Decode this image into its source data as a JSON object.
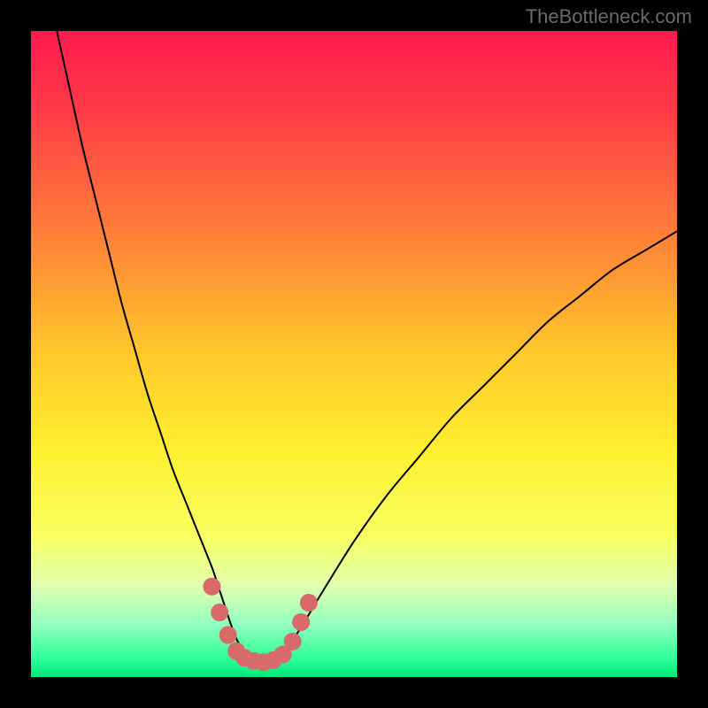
{
  "watermark": "TheBottleneck.com",
  "chart_data": {
    "type": "line",
    "title": "",
    "xlabel": "",
    "ylabel": "",
    "xlim": [
      0,
      100
    ],
    "ylim": [
      0,
      100
    ],
    "background_gradient": {
      "stops": [
        {
          "offset": 0,
          "color": "#ff1a50"
        },
        {
          "offset": 12,
          "color": "#ff3a46"
        },
        {
          "offset": 30,
          "color": "#ff7a3a"
        },
        {
          "offset": 50,
          "color": "#ffc82a"
        },
        {
          "offset": 65,
          "color": "#fff030"
        },
        {
          "offset": 78,
          "color": "#f9ff60"
        },
        {
          "offset": 86,
          "color": "#e0ffb0"
        },
        {
          "offset": 92,
          "color": "#90ffc0"
        },
        {
          "offset": 97,
          "color": "#30ff9a"
        },
        {
          "offset": 100,
          "color": "#00e878"
        }
      ]
    },
    "series": [
      {
        "name": "bottleneck-curve",
        "color": "#000000",
        "x": [
          4,
          6,
          8,
          10,
          12,
          14,
          16,
          18,
          20,
          22,
          24,
          26,
          28,
          29,
          30,
          31,
          32,
          33,
          34,
          35,
          36,
          37,
          38,
          40,
          42,
          45,
          50,
          55,
          60,
          65,
          70,
          75,
          80,
          85,
          90,
          95,
          100
        ],
        "y": [
          100,
          91,
          82,
          74,
          66,
          58,
          51,
          44,
          38,
          32,
          27,
          22,
          17,
          14,
          11,
          8,
          5.5,
          4,
          3,
          2.5,
          2.2,
          2.4,
          3,
          5,
          8,
          13,
          21,
          28,
          34,
          40,
          45,
          50,
          55,
          59,
          63,
          66,
          69
        ]
      }
    ],
    "markers": {
      "name": "highlight-dots",
      "color": "#d96a6a",
      "radius": 10,
      "points": [
        {
          "x": 28.0,
          "y": 14.0
        },
        {
          "x": 29.2,
          "y": 10.0
        },
        {
          "x": 30.5,
          "y": 6.5
        },
        {
          "x": 31.8,
          "y": 4.0
        },
        {
          "x": 33.0,
          "y": 3.0
        },
        {
          "x": 34.5,
          "y": 2.5
        },
        {
          "x": 36.0,
          "y": 2.3
        },
        {
          "x": 37.5,
          "y": 2.6
        },
        {
          "x": 39.0,
          "y": 3.5
        },
        {
          "x": 40.5,
          "y": 5.5
        },
        {
          "x": 41.8,
          "y": 8.5
        },
        {
          "x": 43.0,
          "y": 11.5
        }
      ]
    }
  }
}
